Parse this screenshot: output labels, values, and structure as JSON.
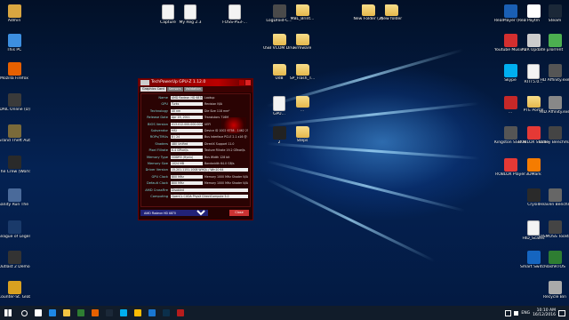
{
  "desktop": {
    "icons": [
      {
        "name": "Admin",
        "kind": "user",
        "color": "#d9a641"
      },
      {
        "name": "This PC",
        "kind": "pc",
        "color": "#3d8fe0"
      },
      {
        "name": "Mozilla Firefox",
        "kind": "app",
        "color": "#e66000"
      },
      {
        "name": "IDAIL Online (D)",
        "kind": "app",
        "color": "#3a3a3a"
      },
      {
        "name": "Grand Theft Auto V",
        "kind": "app",
        "color": "#7a6a3a"
      },
      {
        "name": "The Crew (Worldwide)",
        "kind": "app",
        "color": "#2a2a2a"
      },
      {
        "name": "Sanity Run The Third",
        "kind": "app",
        "color": "#4a6a9a"
      },
      {
        "name": "League of Legends",
        "kind": "app",
        "color": "#1a3a6a"
      },
      {
        "name": "Outlast 2 Demo",
        "kind": "app",
        "color": "#333333"
      },
      {
        "name": "Counter-St. Global Offe...",
        "kind": "app",
        "color": "#d8a020"
      },
      {
        "name": "Capture",
        "kind": "file",
        "color": "#ffffff"
      },
      {
        "name": "My Reg 2.3",
        "kind": "file",
        "color": "#ffffff"
      },
      {
        "name": "FOSS-PS3-...",
        "kind": "file",
        "color": "#ffffff"
      },
      {
        "name": "LogDroid-C...",
        "kind": "app",
        "color": "#4a4a4a"
      },
      {
        "name": "MBL_Brint...",
        "kind": "folder",
        "color": "#e5b84d"
      },
      {
        "name": "New Folder (2)",
        "kind": "folder",
        "color": "#e5b84d"
      },
      {
        "name": "New folder",
        "kind": "folder",
        "color": "#e5b84d"
      },
      {
        "name": "USB VCOM Driver",
        "kind": "folder",
        "color": "#e5b84d"
      },
      {
        "name": "Firmware",
        "kind": "folder",
        "color": "#e5b84d"
      },
      {
        "name": "Ud8",
        "kind": "folder",
        "color": "#e5b84d"
      },
      {
        "name": "SP_Flash_T...",
        "kind": "folder",
        "color": "#e5b84d"
      },
      {
        "name": "GPU...",
        "kind": "file",
        "color": "#ffffff"
      },
      {
        "name": "...",
        "kind": "folder",
        "color": "#e5b84d"
      },
      {
        "name": "2",
        "kind": "app",
        "color": "#222222"
      },
      {
        "name": "Steps",
        "kind": "folder",
        "color": "#e5b84d"
      },
      {
        "name": "RealPlayer (RealTimes)",
        "kind": "app",
        "color": "#1a5fb4"
      },
      {
        "name": "Paytm",
        "kind": "app",
        "color": "#ffffff"
      },
      {
        "name": "Steam",
        "kind": "app",
        "color": "#1b2838"
      },
      {
        "name": "Youtube Music Do...",
        "kind": "app",
        "color": "#d32f2f"
      },
      {
        "name": "AVR Update",
        "kind": "app",
        "color": "#cccccc"
      },
      {
        "name": "µTorrent",
        "kind": "app",
        "color": "#4caf50"
      },
      {
        "name": "Skype",
        "kind": "app",
        "color": "#00aff0"
      },
      {
        "name": "RTIT5.0...",
        "kind": "file",
        "color": "#ffffff"
      },
      {
        "name": "HD Affinity.exe",
        "kind": "app",
        "color": "#555555"
      },
      {
        "name": "...",
        "kind": "app",
        "color": "#c62828"
      },
      {
        "name": "PTE Portal",
        "kind": "folder",
        "color": "#e5b84d"
      },
      {
        "name": "HID Affinity.exe",
        "kind": "app",
        "color": "#888888"
      },
      {
        "name": "Kingston SSD Man...",
        "kind": "app",
        "color": "#555555"
      },
      {
        "name": "ROBLOX Studio",
        "kind": "app",
        "color": "#e53935"
      },
      {
        "name": "Valley Benchma...",
        "kind": "app",
        "color": "#444444"
      },
      {
        "name": "ROBLOX Player",
        "kind": "app",
        "color": "#e53935"
      },
      {
        "name": "3DMark",
        "kind": "app",
        "color": "#f57c00"
      },
      {
        "name": "Crysis",
        "kind": "app",
        "color": "#2a2a2a"
      },
      {
        "name": "Heaven Benchma...",
        "kind": "app",
        "color": "#666666"
      },
      {
        "name": "HID_Scales",
        "kind": "file",
        "color": "#ffffff"
      },
      {
        "name": "DISMOSS Tool4 Line",
        "kind": "app",
        "color": "#444444"
      },
      {
        "name": "Smart Switch",
        "kind": "app",
        "color": "#1565c0"
      },
      {
        "name": "FlashRTOS",
        "kind": "app",
        "color": "#2e7d32"
      },
      {
        "name": "Recycle Bin",
        "kind": "bin",
        "color": "#aaaaaa"
      }
    ]
  },
  "gpuz": {
    "title": "TechPowerUp GPU-Z 1.12.0",
    "tabs": [
      "Graphics Card",
      "Sensors",
      "Validation"
    ],
    "active_tab": "Graphics Card",
    "rows": [
      {
        "label": "Name",
        "value": "AMD Radeon HD 6870",
        "extra": "Lookup"
      },
      {
        "label": "GPU",
        "value": "Turks",
        "extra": "Revision  N/A"
      },
      {
        "label": "Technology",
        "value": "40 nm",
        "extra": "Die Size  118 mm²"
      },
      {
        "label": "Release Date",
        "value": "Apr 19, 2011",
        "extra": "Transistors  716M"
      },
      {
        "label": "BIOS Version",
        "value": "013.012.000.000.000000",
        "extra": "UEFI"
      },
      {
        "label": "Subvendor",
        "value": "MSI",
        "extra": "Device ID  1002 6758 - 1462 2530"
      },
      {
        "label": "ROPs/TMUs",
        "value": "8 / 24",
        "extra": "Bus Interface  PCI-E 2.1 x16 @ x16 1.1"
      },
      {
        "label": "Shaders",
        "value": "480 Unified",
        "extra": "DirectX Support  11.0"
      },
      {
        "label": "Pixel Fillrate",
        "value": "6.4 GPixel/s",
        "extra": "Texture Fillrate  19.2 GTexel/s"
      },
      {
        "label": "Memory Type",
        "value": "GDDR5 (Hynix)",
        "extra": "Bus Width  128 bit"
      },
      {
        "label": "Memory Size",
        "value": "1024 MB",
        "extra": "Bandwidth  64.0 GB/s"
      },
      {
        "label": "Driver Version",
        "value": "15.201.1151.1008 WHQL / Win10 64"
      },
      {
        "label": "GPU Clock",
        "value": "800 MHz",
        "extra": "Memory  1000 MHz   Shader  N/A"
      },
      {
        "label": "Default Clock",
        "value": "800 MHz",
        "extra": "Memory  1000 MHz   Shader  N/A"
      },
      {
        "label": "AMD CrossFire",
        "value": "Disabled"
      },
      {
        "label": "Computing",
        "value": "OpenCL  CUDA  PhysX  DirectCompute 5.0"
      }
    ],
    "selected_card": "AMD Radeon HD 6870",
    "close_label": "Close"
  },
  "taskbar": {
    "apps": [
      {
        "name": "search",
        "color": "#ffffff"
      },
      {
        "name": "task-view",
        "color": "#ffffff"
      },
      {
        "name": "edge",
        "color": "#1e88e5"
      },
      {
        "name": "file-explorer",
        "color": "#f4c542"
      },
      {
        "name": "store",
        "color": "#2e7d32"
      },
      {
        "name": "firefox",
        "color": "#e66000"
      },
      {
        "name": "steam",
        "color": "#1b2838"
      },
      {
        "name": "skype",
        "color": "#00aff0"
      },
      {
        "name": "chrome",
        "color": "#fbbc05"
      },
      {
        "name": "mail",
        "color": "#1976d2"
      },
      {
        "name": "photoshop",
        "color": "#0b2f4b"
      },
      {
        "name": "gpuz",
        "color": "#b71c1c"
      }
    ],
    "time": "10:10 AM",
    "date": "16/12/2016",
    "lang": "ENG"
  }
}
